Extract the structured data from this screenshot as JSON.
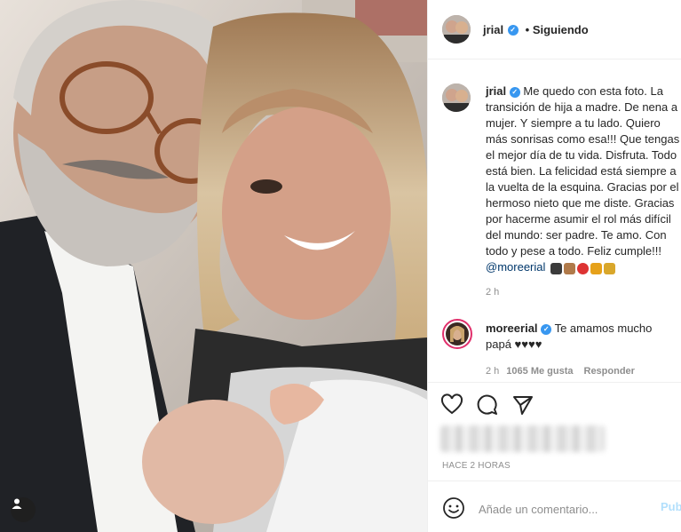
{
  "post": {
    "author": "jrial",
    "follow_status": "Siguiendo",
    "caption_text": "Me quedo con esta foto. La\ntransición de hija a madre. De nena a\nmujer. Y siempre a tu lado. Quiero\nmás sonrisas como esa!!! Que tengas\nel mejor día de tu vida. Disfruta. Todo\nestá bien. La felicidad está siempre a\nla vuelta de la esquina. Gracias por el\nhermoso nieto que me diste. Gracias\npor hacerme asumir el rol más difícil\ndel mundo: ser padre. Te amo. Con\ntodo y pese a todo. Feliz cumple!!!",
    "caption_mention": "@moreerial",
    "caption_time": "2 h",
    "emoji_icons": [
      "baby-bottle-icon",
      "cake-icon",
      "balloon-icon",
      "gift-icon",
      "party-popper-icon"
    ]
  },
  "reply": {
    "author": "moreerial",
    "text": "Te amamos mucho papá ♥♥♥♥",
    "time": "2 h",
    "likes": "1065 Me gusta",
    "reply_label": "Responder"
  },
  "footer": {
    "timestamp": "HACE 2 HORAS",
    "comment_placeholder": "Añade un comentario...",
    "post_label": "Publicar"
  },
  "colors": {
    "verified": "#3897f0",
    "link": "#00376b",
    "muted": "#8e8e8e",
    "post_button_disabled": "#b2dffc"
  }
}
